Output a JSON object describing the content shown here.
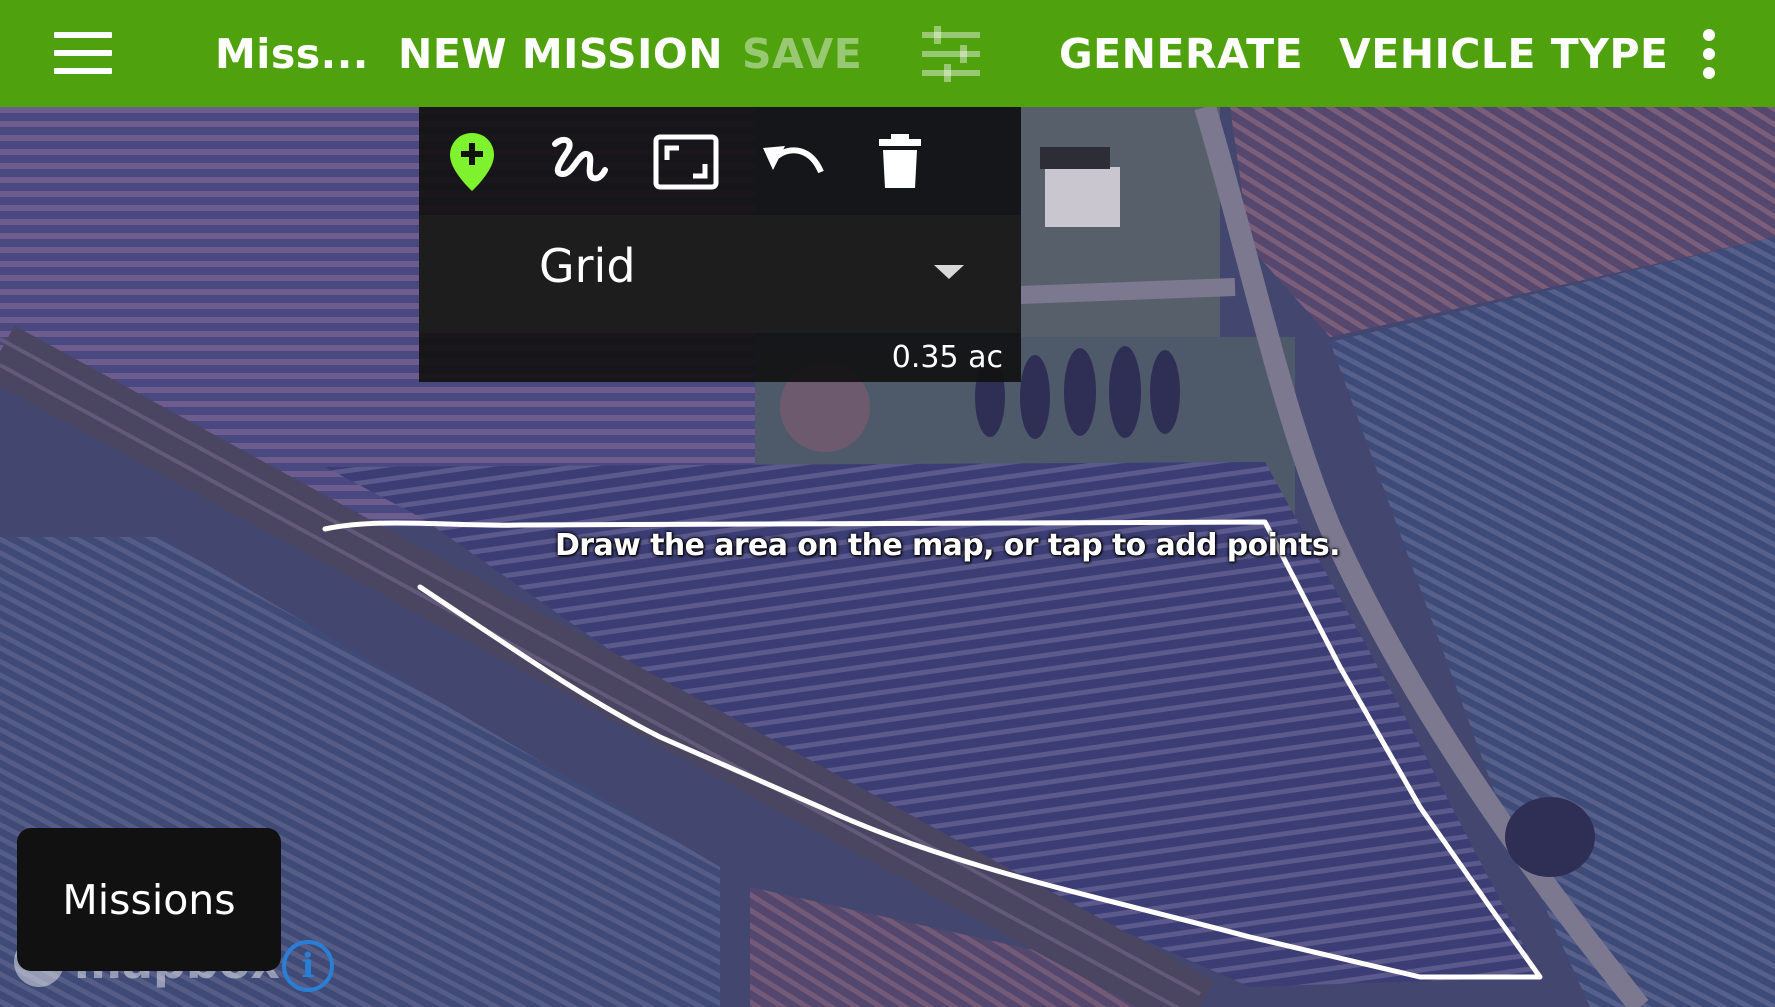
{
  "appbar": {
    "title": "Miss...",
    "new_mission": "NEW MISSION",
    "save": "SAVE",
    "generate": "GENERATE",
    "vehicle_type": "VEHICLE TYPE",
    "icons": [
      "hamburger-menu-icon",
      "tune-icon",
      "more-vert-icon"
    ]
  },
  "toolbar": {
    "tools": [
      "add-location-icon",
      "freehand-draw-icon",
      "fit-to-screen-icon",
      "undo-icon",
      "delete-icon"
    ],
    "pattern_select": {
      "selected": "Grid"
    },
    "area": "0.35 ac"
  },
  "map": {
    "hint": "Draw the area on the map, or tap to add points.",
    "attribution": "mapbox"
  },
  "missions_button": "Missions",
  "colors": {
    "appbar": "#4fa20d",
    "add_point_marker": "#7ef22c",
    "panel": "#121212",
    "info": "#2a7fd4"
  }
}
